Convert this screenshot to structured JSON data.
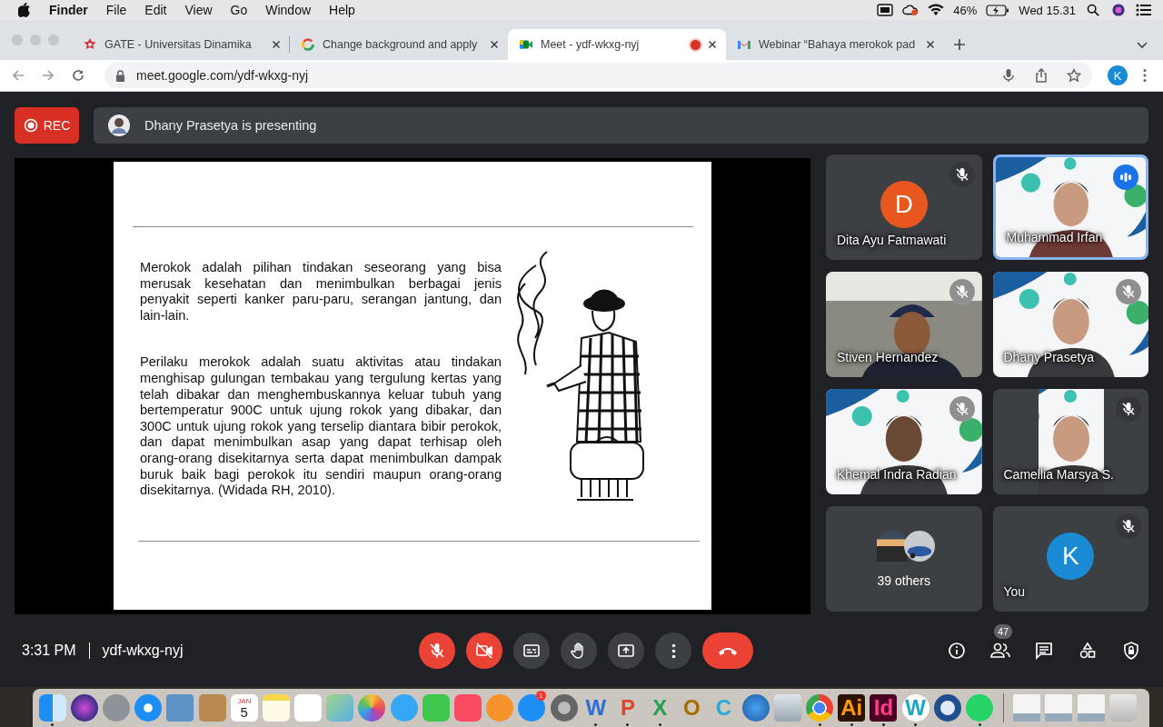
{
  "menu_bar": {
    "items": [
      {
        "label": "Finder",
        "kind": "app"
      },
      {
        "label": "File",
        "kind": "menu"
      },
      {
        "label": "Edit",
        "kind": "menu"
      },
      {
        "label": "View",
        "kind": "menu"
      },
      {
        "label": "Go",
        "kind": "menu"
      },
      {
        "label": "Window",
        "kind": "menu"
      },
      {
        "label": "Help",
        "kind": "menu"
      }
    ],
    "battery_percent": "46%",
    "clock": "Wed 15.31"
  },
  "tabs": [
    {
      "title": "GATE - Universitas Dinamika",
      "kind": "gate",
      "selected": false,
      "recording": false
    },
    {
      "title": "Change background and apply",
      "kind": "google",
      "selected": false,
      "recording": false
    },
    {
      "title": "Meet - ydf-wkxg-nyj",
      "kind": "meet",
      "selected": true,
      "recording": true
    },
    {
      "title": "Webinar “Bahaya merokok pad",
      "kind": "mail",
      "selected": false,
      "recording": false
    }
  ],
  "address_bar": {
    "url": "meet.google.com/ydf-wkxg-nyj",
    "profile_initial": "K"
  },
  "meeting": {
    "rec_label": "REC",
    "presenter_banner": "Dhany Prasetya is presenting",
    "slide": {
      "paragraphs": [
        "Merokok adalah pilihan tindakan seseorang yang bisa merusak kesehatan dan menimbulkan berbagai jenis penyakit seperti kanker paru-paru, serangan jantung, dan lain-lain.",
        "Perilaku merokok adalah suatu aktivitas atau tindakan menghisap gulungan tembakau yang tergulung kertas yang telah dibakar dan menghembuskannya keluar tubuh yang bertemperatur 900C untuk ujung rokok yang dibakar, dan 300C untuk ujung rokok yang terselip diantara bibir perokok, dan dapat menimbulkan asap yang dapat terhisap oleh orang-orang disekitarnya serta dapat menimbulkan dampak buruk baik bagi perokok itu sendiri maupun orang-orang disekitarnya. (Widada RH, 2010)."
      ]
    },
    "participants": [
      {
        "name": "Dita Ayu Fatmawati",
        "kind": "avatar",
        "initial": "D",
        "color": "#e8571e",
        "muted": true,
        "speaking": false
      },
      {
        "name": "Muhammad Irfan",
        "kind": "video",
        "muted": false,
        "speaking": true
      },
      {
        "name": "Stiven Hernandez",
        "kind": "video",
        "muted": true,
        "speaking": false
      },
      {
        "name": "Dhany Prasetya",
        "kind": "video",
        "muted": true,
        "speaking": false
      },
      {
        "name": "Khemal Indra Radian",
        "kind": "video",
        "muted": true,
        "speaking": false
      },
      {
        "name": "Camellia Marsya S.",
        "kind": "portrait",
        "muted": true,
        "speaking": false
      },
      {
        "name": "39 others",
        "kind": "others",
        "muted": false,
        "speaking": false
      },
      {
        "name": "You",
        "kind": "avatar",
        "initial": "K",
        "color": "#1a8ad4",
        "muted": true,
        "speaking": false
      }
    ],
    "clock": "3:31 PM",
    "meeting_code": "ydf-wkxg-nyj",
    "controls": [
      {
        "kind": "mic",
        "alert": true
      },
      {
        "kind": "camera",
        "alert": true
      },
      {
        "kind": "captions",
        "alert": false
      },
      {
        "kind": "hand",
        "alert": false
      },
      {
        "kind": "present",
        "alert": false
      },
      {
        "kind": "more",
        "alert": false
      },
      {
        "kind": "end",
        "alert": true
      }
    ],
    "people_count": "47"
  },
  "dock": [
    {
      "kind": "finder",
      "running": true
    },
    {
      "kind": "siri",
      "running": false
    },
    {
      "kind": "launchpad",
      "running": false
    },
    {
      "kind": "safari",
      "running": false
    },
    {
      "kind": "preview",
      "running": false
    },
    {
      "kind": "contacts",
      "running": false
    },
    {
      "kind": "calendar",
      "glyph": "5",
      "month": "JAN",
      "running": false
    },
    {
      "kind": "notes",
      "running": false
    },
    {
      "kind": "reminders",
      "running": false
    },
    {
      "kind": "maps",
      "running": false
    },
    {
      "kind": "photos",
      "running": false
    },
    {
      "kind": "messages",
      "running": false
    },
    {
      "kind": "facetime",
      "running": false
    },
    {
      "kind": "music",
      "running": false
    },
    {
      "kind": "books",
      "running": false
    },
    {
      "kind": "appstore",
      "badge": "1",
      "running": false
    },
    {
      "kind": "settings",
      "running": false
    },
    {
      "kind": "word",
      "glyph": "W",
      "running": true
    },
    {
      "kind": "powerpoint",
      "glyph": "P",
      "running": true
    },
    {
      "kind": "excel",
      "glyph": "X",
      "running": true
    },
    {
      "kind": "o",
      "glyph": "O",
      "running": false
    },
    {
      "kind": "c",
      "glyph": "C",
      "running": false
    },
    {
      "kind": "globe",
      "running": false
    },
    {
      "kind": "network",
      "running": false
    },
    {
      "kind": "chrome",
      "running": true
    },
    {
      "kind": "ai",
      "glyph": "Ai",
      "running": true
    },
    {
      "kind": "id",
      "glyph": "Id",
      "running": true
    },
    {
      "kind": "wcircle",
      "glyph": "W",
      "running": true
    },
    {
      "kind": "q",
      "running": false
    },
    {
      "kind": "whatsapp",
      "running": true
    },
    {
      "kind": "sep"
    },
    {
      "kind": "doc",
      "running": false
    },
    {
      "kind": "doc",
      "running": false
    },
    {
      "kind": "doc",
      "running": false
    },
    {
      "kind": "trash",
      "running": false
    }
  ]
}
